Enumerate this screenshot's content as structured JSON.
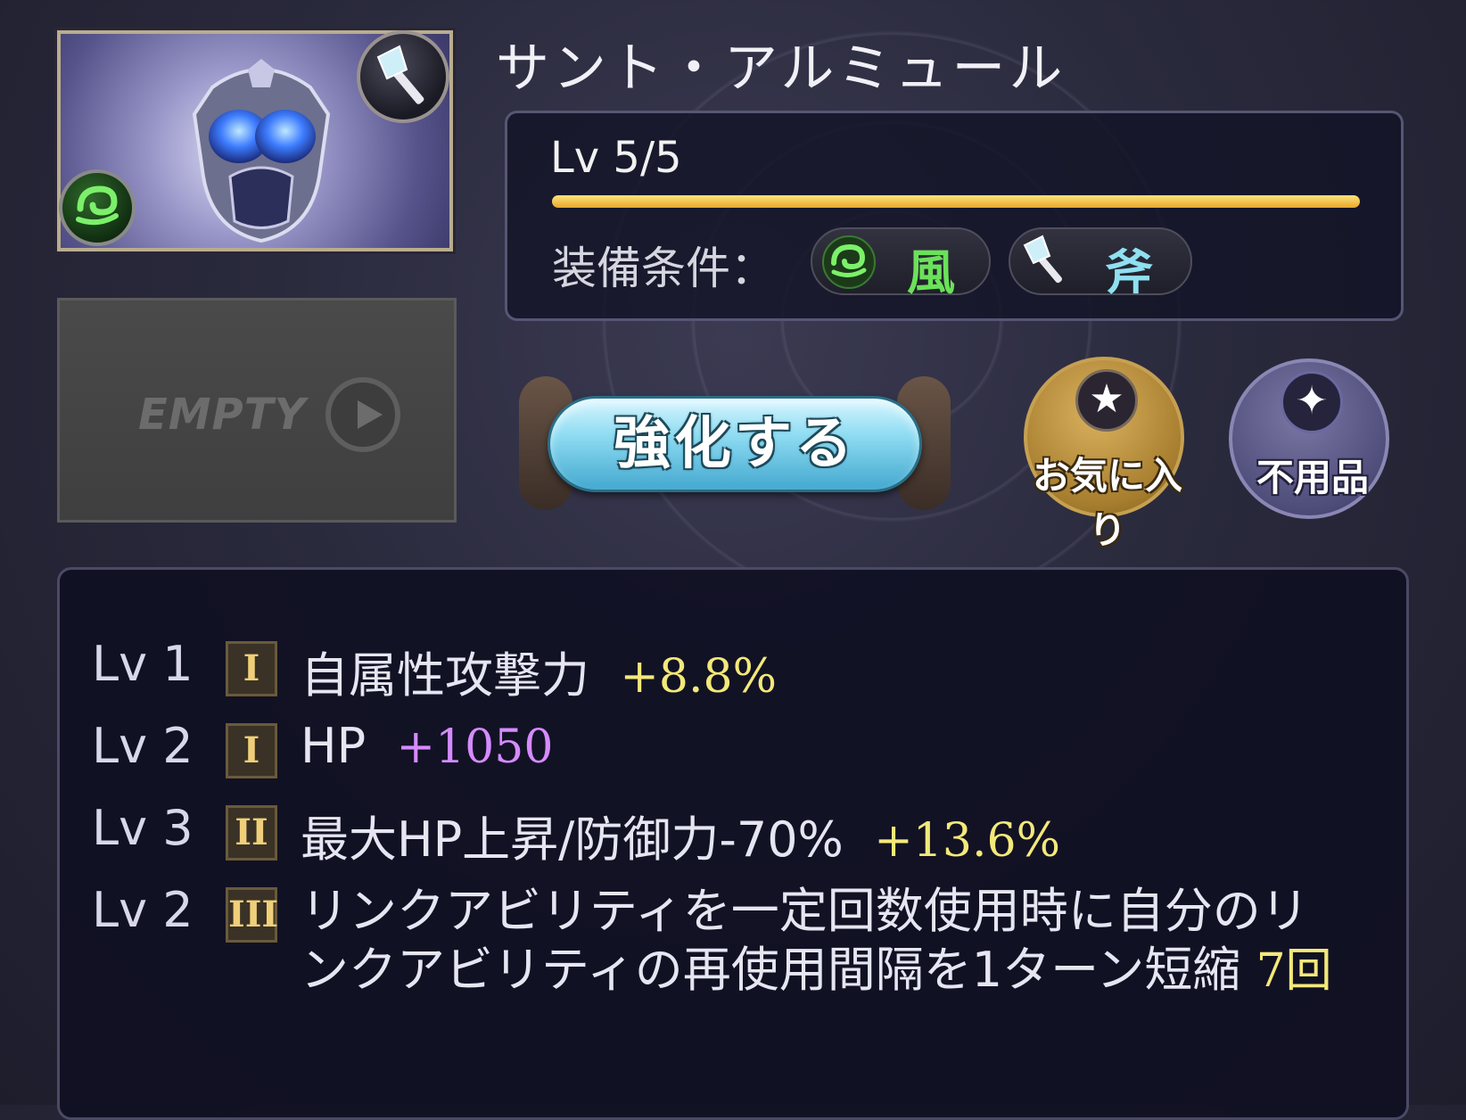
{
  "item": {
    "name": "サント・アルミュール",
    "level_text": "Lv 5/5",
    "level_progress": 1.0,
    "condition_label": "装備条件：",
    "conditions": [
      {
        "label": "風",
        "icon": "wind-element-icon",
        "color": "#6be15a"
      },
      {
        "label": "斧",
        "icon": "axe-icon",
        "color": "#8fe0f0"
      }
    ]
  },
  "empty_slot": {
    "label": "EMPTY"
  },
  "buttons": {
    "enhance": "強化する",
    "favorite": "お気に入り",
    "junk": "不用品"
  },
  "skills": [
    {
      "lv": "Lv 1",
      "rank": "I",
      "name": "自属性攻撃力",
      "value": "+8.8%",
      "value_color": "yellow"
    },
    {
      "lv": "Lv 2",
      "rank": "I",
      "name": "HP",
      "value": "+1050",
      "value_color": "purple"
    },
    {
      "lv": "Lv 3",
      "rank": "II",
      "name": "最大HP上昇/防御力-70%",
      "value": "+13.6%",
      "value_color": "yellow"
    },
    {
      "lv": "Lv 2",
      "rank": "III",
      "name": "リンクアビリティを一定回数使用時に自分のリンクアビリティの再使用間隔を1ターン短縮",
      "value": "7回",
      "value_color": "yellow"
    }
  ],
  "colors": {
    "accent_gold": "#e7a82e",
    "value_yellow": "#f3e979",
    "value_purple": "#d68bff"
  }
}
